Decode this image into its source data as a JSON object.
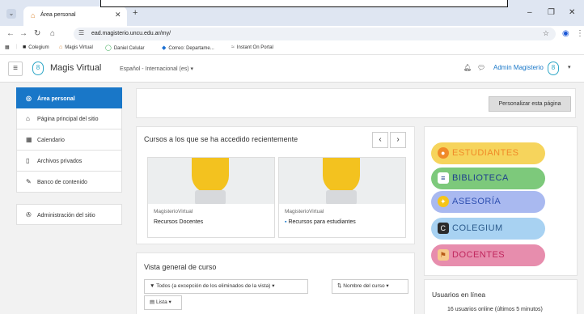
{
  "browser": {
    "tab_title": "Área personal",
    "url": "ead.magisterio.uncu.edu.ar/my/",
    "bookmarks": [
      {
        "label": "Colegium",
        "icon": "colegium-icon"
      },
      {
        "label": "Magis Virtual",
        "icon": "moodle-icon"
      },
      {
        "label": "Daniel Celular",
        "icon": "whatsapp-icon"
      },
      {
        "label": "Correo: Departame...",
        "icon": "outlook-icon"
      },
      {
        "label": "Instant On Portal",
        "icon": "instant-on-icon"
      }
    ]
  },
  "header": {
    "site_name": "Magis Virtual",
    "language": "Español - Internacional (es) ▾",
    "user_name": "Admin Magisterio"
  },
  "sidebar": {
    "items": [
      {
        "label": "Área personal",
        "icon": "dashboard-icon",
        "active": true
      },
      {
        "label": "Página principal del sitio",
        "icon": "home-icon"
      },
      {
        "label": "Calendario",
        "icon": "calendar-icon"
      },
      {
        "label": "Archivos privados",
        "icon": "file-icon"
      },
      {
        "label": "Banco de contenido",
        "icon": "pencil-icon"
      },
      {
        "label": "Administración del sitio",
        "icon": "wrench-icon"
      }
    ]
  },
  "main": {
    "customize_button": "Personalizar esta página",
    "recent_title": "Cursos a los que se ha accedido recientemente",
    "courses": [
      {
        "category": "MagisterioVirtual",
        "name": "Recursos Docentes"
      },
      {
        "category": "MagisterioVirtual",
        "name": "Recursos para estudiantes"
      }
    ],
    "overview_title": "Vista general de curso",
    "filter_label": "Todos (a excepción de los eliminados de la vista) ▾",
    "sort_label": "Nombre del curso ▾",
    "view_label": "Lista ▾"
  },
  "right": {
    "banners": [
      "ESTUDIANTES",
      "BIBLIOTECA",
      "ASESORÍA",
      "COLEGIUM",
      "DOCENTES"
    ],
    "online_title": "Usuarios en línea",
    "online_text": "16 usuarios online (últimos 5 minutos)"
  },
  "colors": {
    "primary": "#1977c8",
    "bulb": "#f3c21f"
  }
}
